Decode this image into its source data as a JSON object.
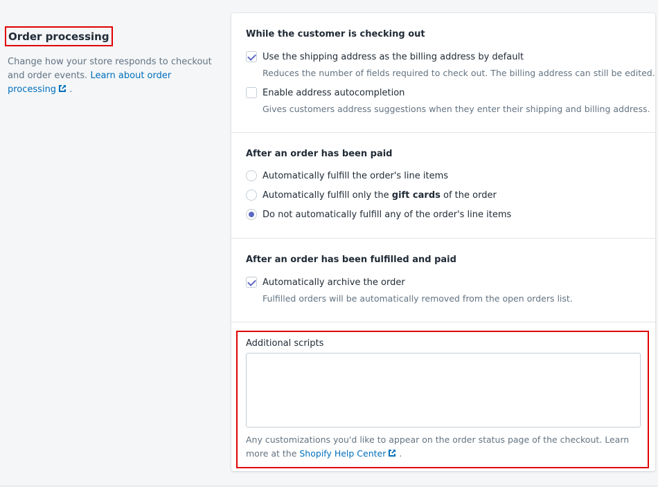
{
  "left": {
    "title": "Order processing",
    "desc_text": "Change how your store responds to checkout and order events. ",
    "desc_link": "Learn about order processing",
    "desc_end": "."
  },
  "checkout": {
    "title": "While the customer is checking out",
    "opt1_label": "Use the shipping address as the billing address by default",
    "opt1_help": "Reduces the number of fields required to check out. The billing address can still be edited.",
    "opt2_label": "Enable address autocompletion",
    "opt2_help": "Gives customers address suggestions when they enter their shipping and billing address."
  },
  "paid": {
    "title": "After an order has been paid",
    "radio1_label": "Automatically fulfill the order's line items",
    "radio2_pre": "Automatically fulfill only the ",
    "radio2_bold": "gift cards",
    "radio2_post": " of the order",
    "radio3_label": "Do not automatically fulfill any of the order's line items"
  },
  "fulfilled": {
    "title": "After an order has been fulfilled and paid",
    "opt_label": "Automatically archive the order",
    "opt_help": "Fulfilled orders will be automatically removed from the open orders list."
  },
  "scripts": {
    "label": "Additional scripts",
    "value": "",
    "help_text": "Any customizations you'd like to appear on the order status page of the checkout. Learn more at the ",
    "help_link": "Shopify Help Center",
    "help_end": "."
  },
  "colors": {
    "accent": "#5c6ac4",
    "link": "#006fbb",
    "highlight": "#e00000"
  },
  "icons": {
    "external_link": "external-link-icon",
    "checkmark": "checkmark-icon"
  }
}
